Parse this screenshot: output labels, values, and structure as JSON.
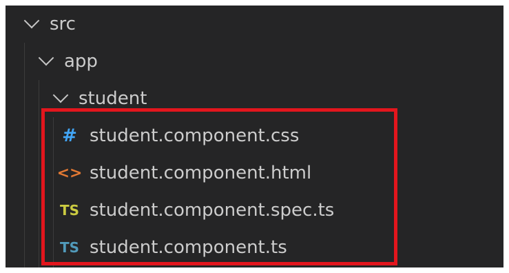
{
  "explorer": {
    "folders": [
      {
        "label": "src",
        "icon": "chevron-down-icon"
      },
      {
        "label": "app",
        "icon": "chevron-down-icon"
      },
      {
        "label": "student",
        "icon": "chevron-down-icon"
      }
    ],
    "files": [
      {
        "label": "student.component.css",
        "icon": "css-hash-icon",
        "glyph": "#",
        "color": "#42a5f5"
      },
      {
        "label": "student.component.html",
        "icon": "html-angle-brackets-icon",
        "glyph": "<>",
        "color": "#e37933"
      },
      {
        "label": "student.component.spec.ts",
        "icon": "typescript-spec-icon",
        "glyph": "TS",
        "color": "#cbcb41"
      },
      {
        "label": "student.component.ts",
        "icon": "typescript-icon",
        "glyph": "TS",
        "color": "#519aba"
      }
    ]
  },
  "colors": {
    "background": "#252526",
    "text": "#cccccc",
    "highlight_border": "#e3161d"
  }
}
